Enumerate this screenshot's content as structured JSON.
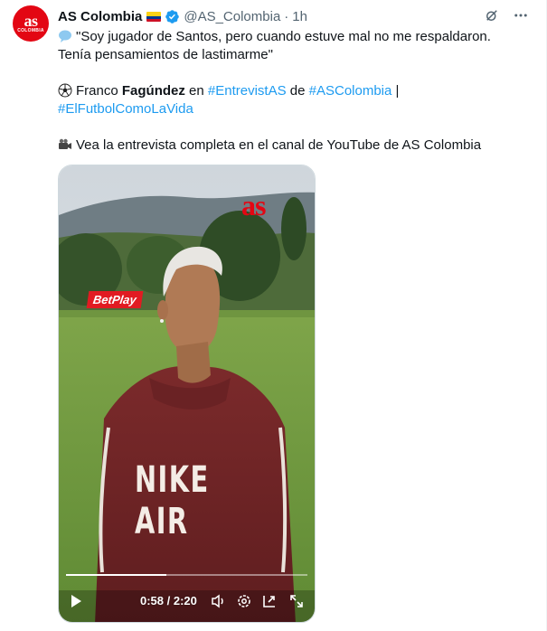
{
  "account": {
    "avatar_text": "as",
    "avatar_subtext": "COLOMBIA",
    "name": "AS Colombia",
    "handle": "@AS_Colombia",
    "separator": "·",
    "time": "1h"
  },
  "tweet": {
    "line1": "\"Soy jugador de Santos, pero cuando estuve mal no me respaldaron.",
    "line2": "Tenía pensamientos de lastimarme\"",
    "person_prefix": "Franco ",
    "person_bold": "Fagúndez",
    "person_en": " en ",
    "tag1": "#EntrevistAS",
    "person_de": " de ",
    "tag2": "#ASColombia",
    "pipe": " |",
    "tag3": "#ElFutbolComoLaVida",
    "cta": "Vea la entrevista completa en el canal de YouTube de AS Colombia"
  },
  "video": {
    "watermark": "as",
    "sign": "BetPlay",
    "shirt_text": "NIKE AIR",
    "current_time": "0:58",
    "duration": "2:20",
    "timecode": "0:58 / 2:20",
    "progress": 0.414
  },
  "icons": [
    "grok-icon",
    "more-icon",
    "speech-bubble-icon",
    "soccer-ball-icon",
    "video-camera-icon",
    "play-icon",
    "volume-icon",
    "settings-icon",
    "pip-icon",
    "fullscreen-icon",
    "verified-icon",
    "flag-colombia-icon"
  ],
  "colors": {
    "link": "#1d9bf0",
    "brand_red": "#e30613",
    "verified": "#1d9bf0",
    "secondary_text": "#536471"
  }
}
